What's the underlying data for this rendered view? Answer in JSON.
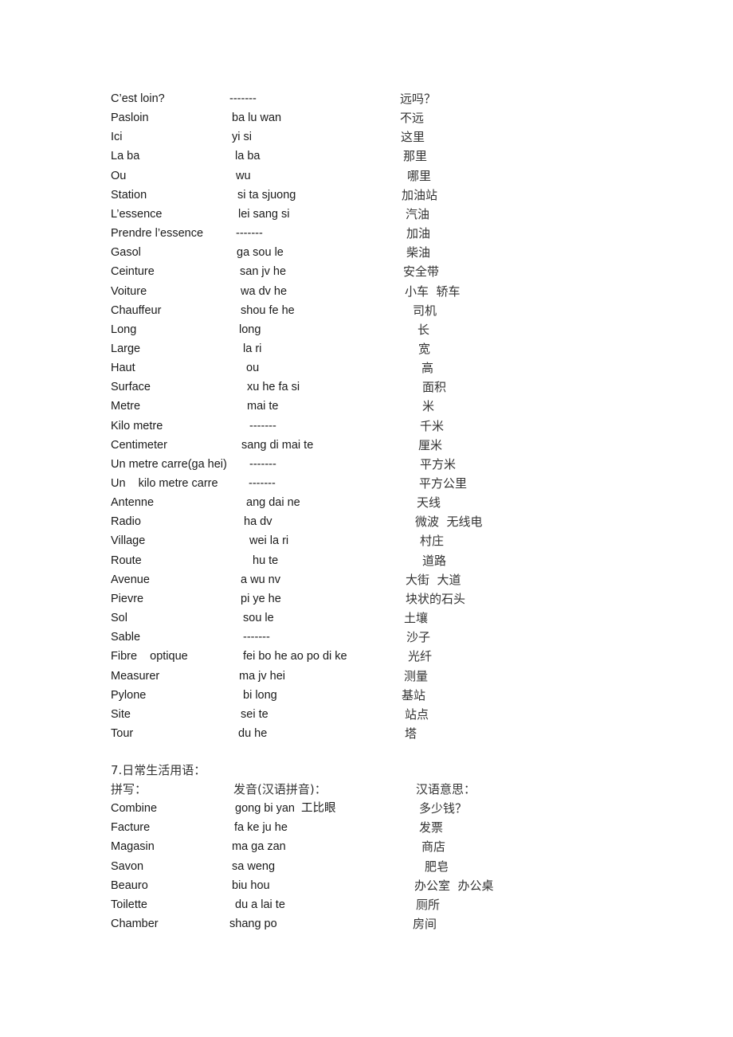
{
  "vocab_section": {
    "rows": [
      {
        "french": "C’est loin?",
        "pronunciation": "-------",
        "chinese": "远吗？"
      },
      {
        "french": "Pasloin",
        "pronunciation": "ba lu wan",
        "chinese": "不远"
      },
      {
        "french": "Ici",
        "pronunciation": "yi si",
        "chinese": "这里"
      },
      {
        "french": "La ba",
        "pronunciation": "la ba",
        "chinese": "那里"
      },
      {
        "french": "Ou",
        "pronunciation": "wu",
        "chinese": "哪里"
      },
      {
        "french": "Station",
        "pronunciation": "si ta sjuong",
        "chinese": "加油站"
      },
      {
        "french": "L’essence",
        "pronunciation": "lei sang si",
        "chinese": "汽油"
      },
      {
        "french": "Prendre l’essence",
        "pronunciation": "-------",
        "chinese": "加油"
      },
      {
        "french": "Gasol",
        "pronunciation": "ga sou le",
        "chinese": "柴油"
      },
      {
        "french": "Ceinture",
        "pronunciation": "san jv he",
        "chinese": "安全带"
      },
      {
        "french": "Voiture",
        "pronunciation": "wa dv he",
        "chinese": "小车  轿车"
      },
      {
        "french": "Chauffeur",
        "pronunciation": "shou fe he",
        "chinese": "司机"
      },
      {
        "french": "Long",
        "pronunciation": "long",
        "chinese": "长"
      },
      {
        "french": "Large",
        "pronunciation": "la ri",
        "chinese": "宽"
      },
      {
        "french": "Haut",
        "pronunciation": "ou",
        "chinese": "高"
      },
      {
        "french": "Surface",
        "pronunciation": "xu he fa si",
        "chinese": "面积"
      },
      {
        "french": "Metre",
        "pronunciation": "mai te",
        "chinese": "米"
      },
      {
        "french": "Kilo metre",
        "pronunciation": "-------",
        "chinese": "千米"
      },
      {
        "french": "Centimeter",
        "pronunciation": "sang di mai te",
        "chinese": "厘米"
      },
      {
        "french": "Un metre carre(ga hei)",
        "pronunciation": "-------",
        "chinese": "平方米"
      },
      {
        "french": "Un    kilo metre carre",
        "pronunciation": "-------",
        "chinese": "平方公里"
      },
      {
        "french": "Antenne",
        "pronunciation": "ang dai ne",
        "chinese": "天线"
      },
      {
        "french": "Radio",
        "pronunciation": "ha dv",
        "chinese": "微波  无线电"
      },
      {
        "french": "Village",
        "pronunciation": "wei la ri",
        "chinese": "村庄"
      },
      {
        "french": "Route",
        "pronunciation": "hu te",
        "chinese": "道路"
      },
      {
        "french": "Avenue",
        "pronunciation": "a wu nv",
        "chinese": "大街  大道"
      },
      {
        "french": "Pievre",
        "pronunciation": "pi ye he",
        "chinese": "块状的石头"
      },
      {
        "french": "Sol",
        "pronunciation": "sou le",
        "chinese": "土壤"
      },
      {
        "french": "Sable",
        "pronunciation": "-------",
        "chinese": "沙子"
      },
      {
        "french": "Fibre    optique",
        "pronunciation": "fei bo he ao po di ke",
        "chinese": "光纤"
      },
      {
        "french": "Measurer",
        "pronunciation": "ma jv hei",
        "chinese": "测量"
      },
      {
        "french": "Pylone",
        "pronunciation": "bi long",
        "chinese": "基站"
      },
      {
        "french": "Site",
        "pronunciation": "sei te",
        "chinese": "站点"
      },
      {
        "french": "Tour",
        "pronunciation": "du he",
        "chinese": "塔"
      }
    ]
  },
  "daily_section": {
    "heading": "7.日常生活用语：",
    "column_headers": {
      "spelling": "拼写：",
      "pronunciation": "发音(汉语拼音)：",
      "meaning": "汉语意思："
    },
    "rows": [
      {
        "french": "Combine",
        "pronunciation": "gong bi yan  工比眼",
        "chinese": "多少钱？"
      },
      {
        "french": "Facture",
        "pronunciation": "fa ke ju he",
        "chinese": "发票"
      },
      {
        "french": "Magasin",
        "pronunciation": "ma ga zan",
        "chinese": "商店"
      },
      {
        "french": "Savon",
        "pronunciation": "sa weng",
        "chinese": "肥皂"
      },
      {
        "french": "Beauro",
        "pronunciation": "biu hou",
        "chinese": "办公室  办公桌"
      },
      {
        "french": "Toilette",
        "pronunciation": "du a lai te",
        "chinese": "厕所"
      },
      {
        "french": "Chamber",
        "pronunciation": "shang po",
        "chinese": "房间"
      }
    ]
  }
}
